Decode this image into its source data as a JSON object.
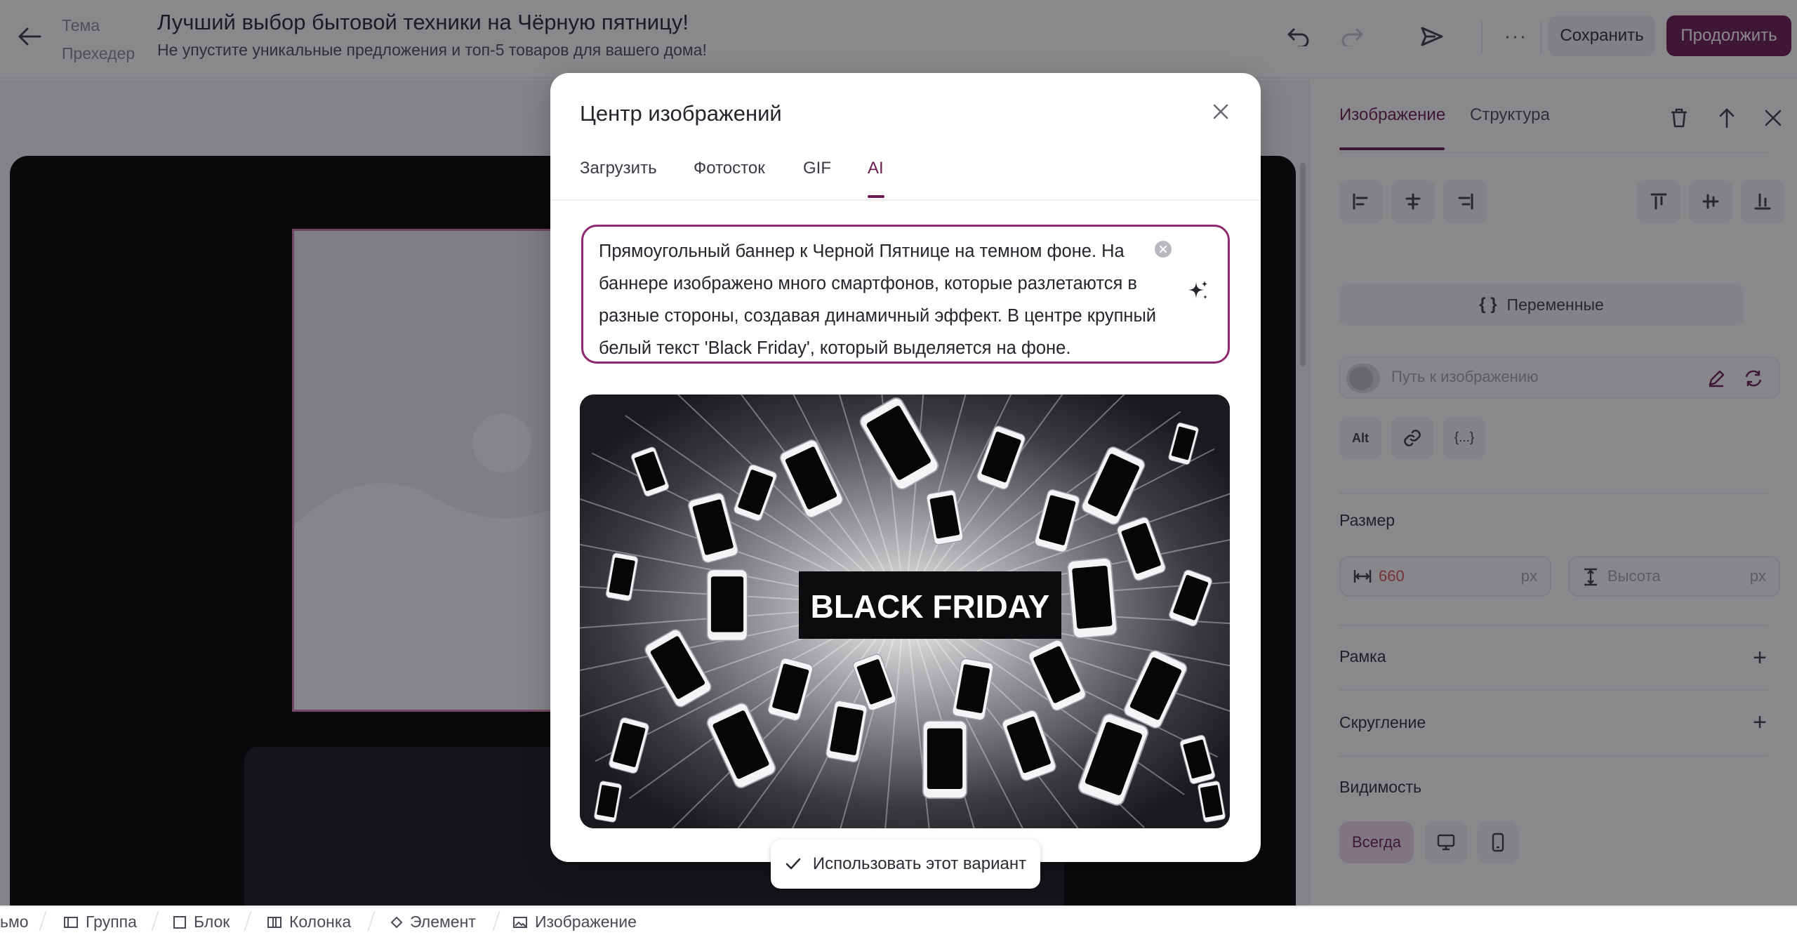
{
  "topbar": {
    "subject_label": "Тема",
    "preheader_label": "Прехедер",
    "subject": "Лучший выбор бытовой техники на Чёрную пятницу!",
    "preheader": "Не упустите уникальные предложения и топ-5 товаров для вашего дома!",
    "more_label": "···",
    "save_label": "Сохранить",
    "continue_label": "Продолжить"
  },
  "panel": {
    "tabs": [
      {
        "label": "Изображение",
        "active": true
      },
      {
        "label": "Структура",
        "active": false
      }
    ],
    "variables_label": "Переменные",
    "path_placeholder": "Путь к изображению",
    "alt_label": "Alt",
    "size_label": "Размер",
    "width_value": "660",
    "height_placeholder": "Высота",
    "unit": "px",
    "border_label": "Рамка",
    "rounding_label": "Скругление",
    "visibility_label": "Видимость",
    "visibility_always": "Всегда"
  },
  "breadcrumbs": [
    {
      "label": "ьмо",
      "icon": "letter-icon"
    },
    {
      "label": "Группа",
      "icon": "group-icon"
    },
    {
      "label": "Блок",
      "icon": "block-icon"
    },
    {
      "label": "Колонка",
      "icon": "column-icon"
    },
    {
      "label": "Элемент",
      "icon": "element-icon"
    },
    {
      "label": "Изображение",
      "icon": "image-icon"
    }
  ],
  "modal": {
    "title": "Центр изображений",
    "tabs": [
      {
        "label": "Загрузить",
        "active": false
      },
      {
        "label": "Фотосток",
        "active": false
      },
      {
        "label": "GIF",
        "active": false
      },
      {
        "label": "AI",
        "active": true
      }
    ],
    "prompt": "Прямоугольный баннер к Черной Пятнице на темном фоне. На баннере изображено много смартфонов,  которые разлетаются в разные стороны, создавая динамичный эффект. В центре крупный белый текст 'Black Friday',  который выделяется на фоне.",
    "generated_image_text": "BLACK FRIDAY",
    "use_button_label": "Использовать этот вариант"
  },
  "colors": {
    "accent": "#6b1b52",
    "accent_light": "#ecd9e6",
    "width_value_color": "#d9534f",
    "overlay": "rgba(20,20,26,0.50)"
  }
}
